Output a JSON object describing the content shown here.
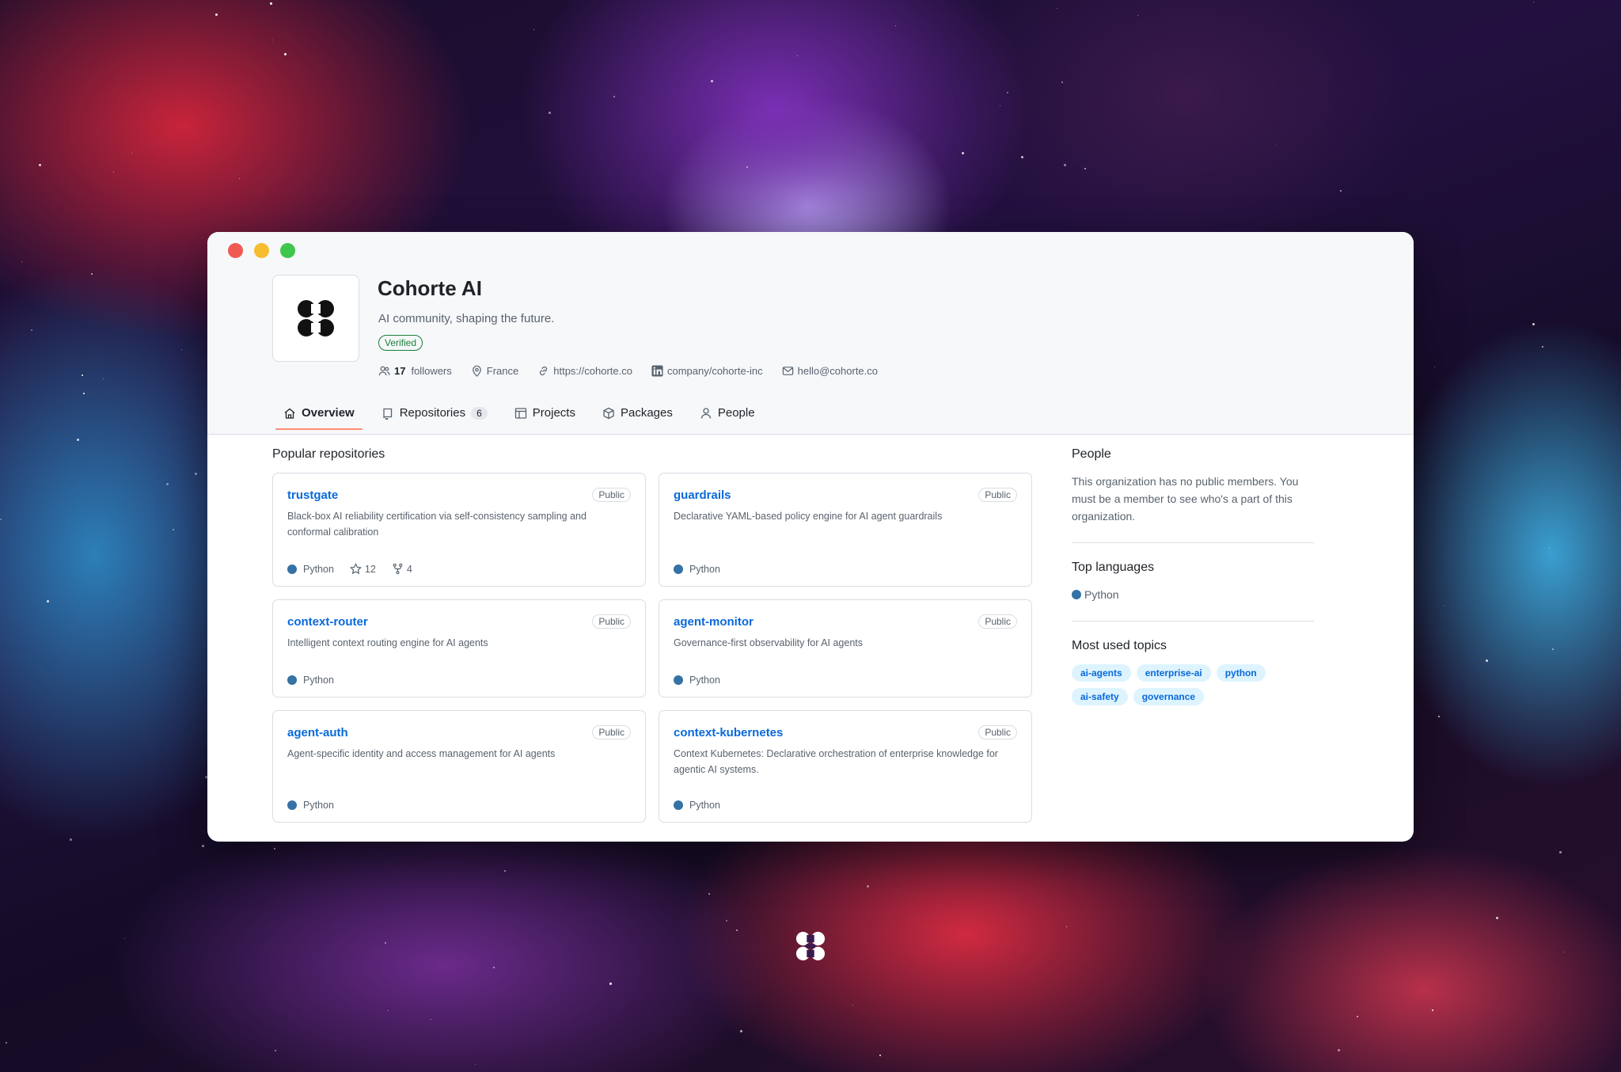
{
  "window": {
    "org": {
      "name": "Cohorte AI",
      "description": "AI community, shaping the future.",
      "verified_label": "Verified"
    },
    "meta": {
      "followers_count": "17",
      "followers_label": "followers",
      "location": "France",
      "website": "https://cohorte.co",
      "linkedin": "company/cohorte-inc",
      "email": "hello@cohorte.co"
    },
    "tabs": [
      {
        "label": "Overview",
        "icon": "home-icon",
        "active": true
      },
      {
        "label": "Repositories",
        "icon": "repo-icon",
        "count": "6"
      },
      {
        "label": "Projects",
        "icon": "table-icon"
      },
      {
        "label": "Packages",
        "icon": "package-icon"
      },
      {
        "label": "People",
        "icon": "person-icon"
      }
    ]
  },
  "main": {
    "popular_title": "Popular repositories",
    "repos": [
      {
        "name": "trustgate",
        "visibility": "Public",
        "description": "Black-box AI reliability certification via self-consistency sampling and conformal calibration",
        "language": "Python",
        "stars": "12",
        "forks": "4"
      },
      {
        "name": "guardrails",
        "visibility": "Public",
        "description": "Declarative YAML-based policy engine for AI agent guardrails",
        "language": "Python"
      },
      {
        "name": "context-router",
        "visibility": "Public",
        "description": "Intelligent context routing engine for AI agents",
        "language": "Python"
      },
      {
        "name": "agent-monitor",
        "visibility": "Public",
        "description": "Governance-first observability for AI agents",
        "language": "Python"
      },
      {
        "name": "agent-auth",
        "visibility": "Public",
        "description": "Agent-specific identity and access management for AI agents",
        "language": "Python"
      },
      {
        "name": "context-kubernetes",
        "visibility": "Public",
        "description": "Context Kubernetes: Declarative orchestration of enterprise knowledge for agentic AI systems.",
        "language": "Python"
      }
    ]
  },
  "sidebar": {
    "people_title": "People",
    "people_text": "This organization has no public members. You must be a member to see who's a part of this organization.",
    "languages_title": "Top languages",
    "top_language": "Python",
    "topics_title": "Most used topics",
    "topics": [
      "ai-agents",
      "enterprise-ai",
      "python",
      "ai-safety",
      "governance"
    ]
  },
  "colors": {
    "python": "#3572a5",
    "link": "#0969da",
    "tab_underline": "#fd8c73"
  }
}
